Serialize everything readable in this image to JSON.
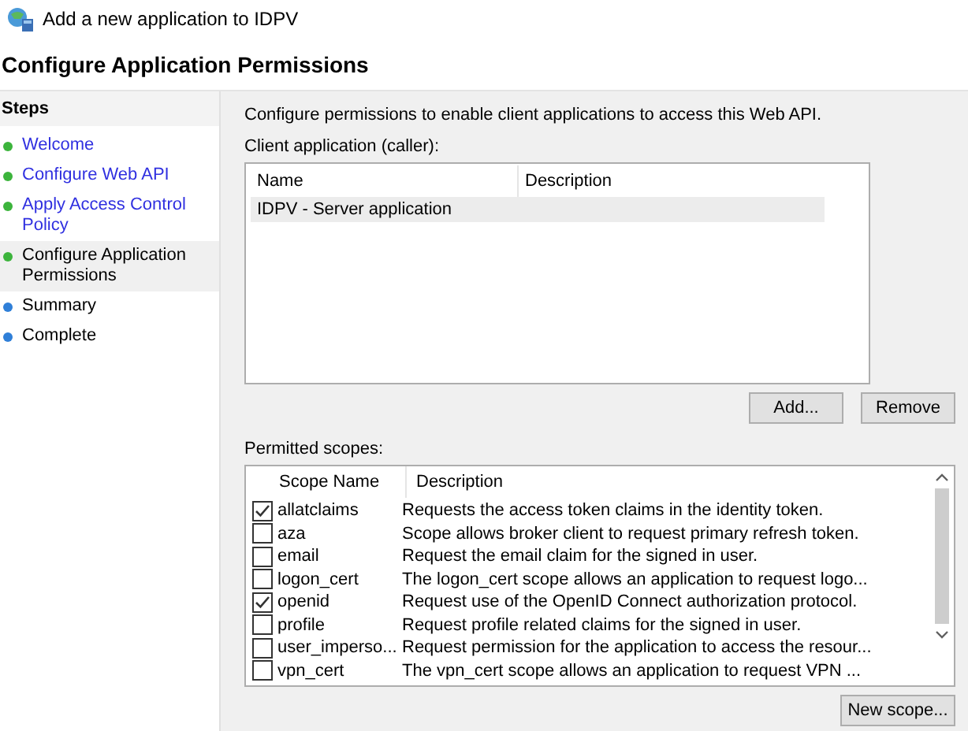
{
  "window": {
    "title": "Add a new application to IDPV"
  },
  "heading": "Configure Application Permissions",
  "steps": {
    "title": "Steps",
    "items": [
      {
        "label": "Welcome",
        "color": "#3cb43c",
        "link": true,
        "selected": false
      },
      {
        "label": "Configure Web API",
        "color": "#3cb43c",
        "link": true,
        "selected": false
      },
      {
        "label": "Apply Access Control Policy",
        "color": "#3cb43c",
        "link": true,
        "selected": false
      },
      {
        "label": "Configure Application Permissions",
        "color": "#3cb43c",
        "link": false,
        "selected": true
      },
      {
        "label": "Summary",
        "color": "#2f7fd8",
        "link": false,
        "selected": false
      },
      {
        "label": "Complete",
        "color": "#2f7fd8",
        "link": false,
        "selected": false
      }
    ]
  },
  "intro": "Configure permissions to enable client applications to access this Web API.",
  "clients": {
    "label": "Client application (caller):",
    "columns": [
      "Name",
      "Description"
    ],
    "rows": [
      {
        "name": "IDPV - Server application",
        "selected": true
      }
    ]
  },
  "client_buttons": [
    "Add...",
    "Remove"
  ],
  "scopes": {
    "label": "Permitted scopes:",
    "columns": [
      "Scope Name",
      "Description"
    ],
    "rows": [
      {
        "name": "allatclaims",
        "description": "Requests the access token claims in the identity token.",
        "checked": true
      },
      {
        "name": "aza",
        "description": "Scope allows broker client to request primary refresh token.",
        "checked": false
      },
      {
        "name": "email",
        "description": "Request the email claim for the signed in user.",
        "checked": false
      },
      {
        "name": "logon_cert",
        "description": "The logon_cert scope allows an application to request logo...",
        "checked": false
      },
      {
        "name": "openid",
        "description": "Request use of the OpenID Connect authorization protocol.",
        "checked": true
      },
      {
        "name": "profile",
        "description": "Request profile related claims for the signed in user.",
        "checked": false
      },
      {
        "name": "user_imperso...",
        "description": "Request permission for the application to access the resour...",
        "checked": false
      },
      {
        "name": "vpn_cert",
        "description": "The vpn_cert scope allows an application to request VPN ...",
        "checked": false
      }
    ]
  },
  "scope_button": "New scope..."
}
